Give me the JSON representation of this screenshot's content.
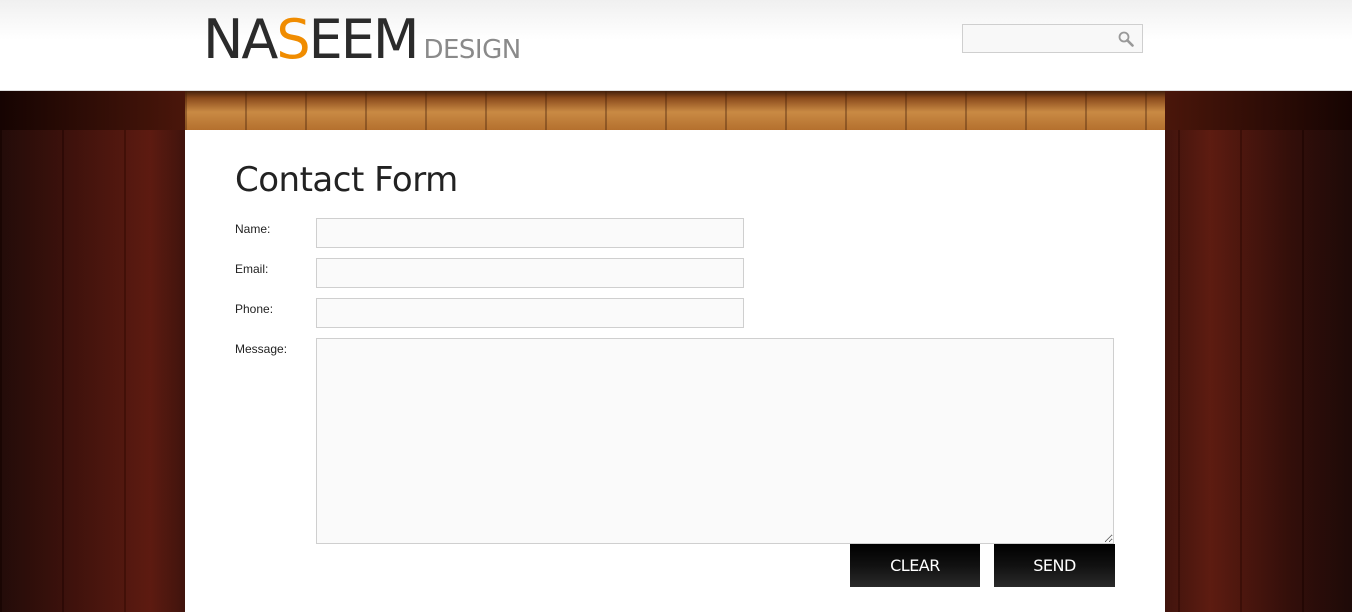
{
  "header": {
    "logo": {
      "part1": "NA",
      "accent": "S",
      "part2": "EEM",
      "sub": "DESIGN"
    },
    "search": {
      "placeholder": "",
      "icon": "search-icon"
    }
  },
  "colors": {
    "accent": "#f08c00",
    "button": "#000000",
    "panel": "#ffffff"
  },
  "form": {
    "title": "Contact Form",
    "fields": {
      "name": {
        "label": "Name:",
        "value": ""
      },
      "email": {
        "label": "Email:",
        "value": ""
      },
      "phone": {
        "label": "Phone:",
        "value": ""
      },
      "message": {
        "label": "Message:",
        "value": ""
      }
    },
    "buttons": {
      "clear": "CLEAR",
      "send": "SEND"
    }
  }
}
